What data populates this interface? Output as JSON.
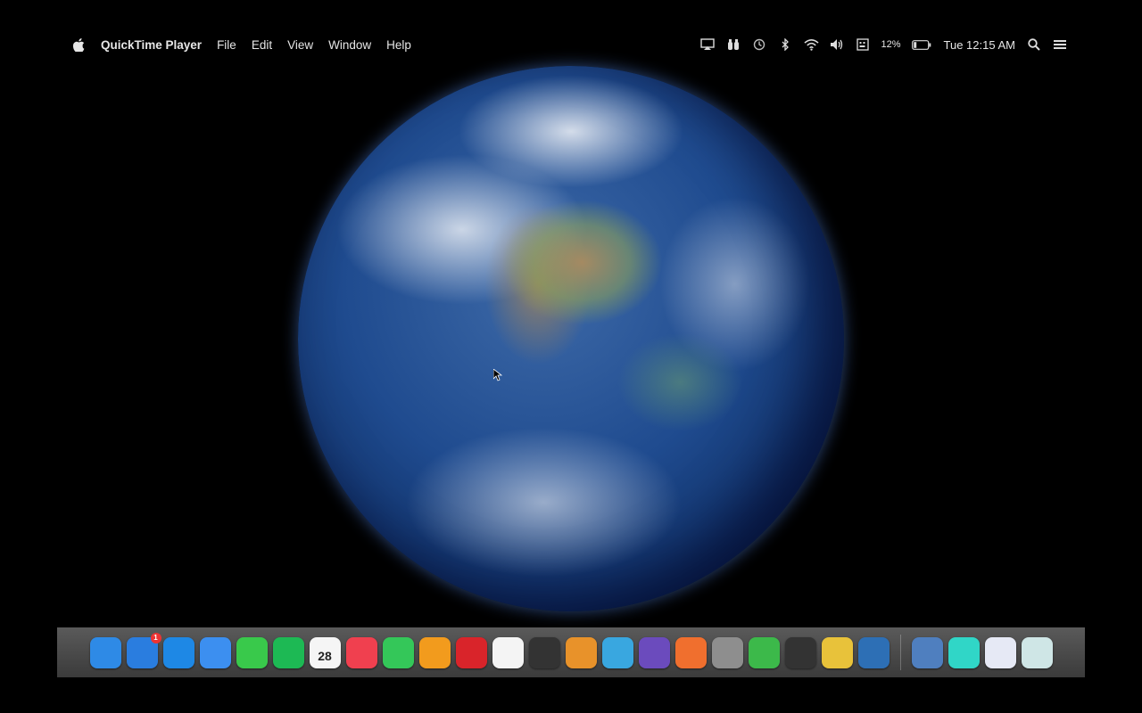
{
  "menubar": {
    "app_name": "QuickTime Player",
    "menus": [
      "File",
      "Edit",
      "View",
      "Window",
      "Help"
    ],
    "status_icons": [
      "airplay-icon",
      "binoculars-icon",
      "time-machine-icon",
      "bluetooth-icon",
      "wifi-icon",
      "volume-icon",
      "keyboard-icon"
    ],
    "battery_percent": "12%",
    "clock": "Tue 12:15 AM"
  },
  "dock": {
    "items": [
      {
        "name": "finder",
        "color": "#2e8ae6"
      },
      {
        "name": "app-store",
        "color": "#2a7ddf",
        "badge": "1"
      },
      {
        "name": "safari",
        "color": "#1e88e5"
      },
      {
        "name": "mail",
        "color": "#3c8ff0"
      },
      {
        "name": "messages",
        "color": "#39c94b"
      },
      {
        "name": "spotify",
        "color": "#1db954"
      },
      {
        "name": "calendar",
        "color": "#f5f5f5",
        "label": "28"
      },
      {
        "name": "music",
        "color": "#f0404f"
      },
      {
        "name": "facetime",
        "color": "#34c759"
      },
      {
        "name": "ibooks",
        "color": "#f29b1d"
      },
      {
        "name": "photo-booth",
        "color": "#d9242a"
      },
      {
        "name": "reminders",
        "color": "#f4f4f4"
      },
      {
        "name": "utility",
        "color": "#333333"
      },
      {
        "name": "keynote",
        "color": "#e8922a"
      },
      {
        "name": "preview",
        "color": "#39a7e0"
      },
      {
        "name": "imovie",
        "color": "#6b4bbd"
      },
      {
        "name": "garageband",
        "color": "#f06f2e"
      },
      {
        "name": "system-preferences",
        "color": "#8e8e8e"
      },
      {
        "name": "minecraft",
        "color": "#3cb94a"
      },
      {
        "name": "call-of-duty",
        "color": "#333333"
      },
      {
        "name": "tool-app",
        "color": "#e8c23a"
      },
      {
        "name": "quicktime",
        "color": "#2d6fb5"
      },
      {
        "name": "clipping-tool",
        "color": "#4f7fbf"
      },
      {
        "name": "document-app",
        "color": "#30d6c7"
      },
      {
        "name": "downloads",
        "color": "#e6e9f5"
      },
      {
        "name": "trash",
        "color": "#cfe6e6"
      }
    ]
  }
}
